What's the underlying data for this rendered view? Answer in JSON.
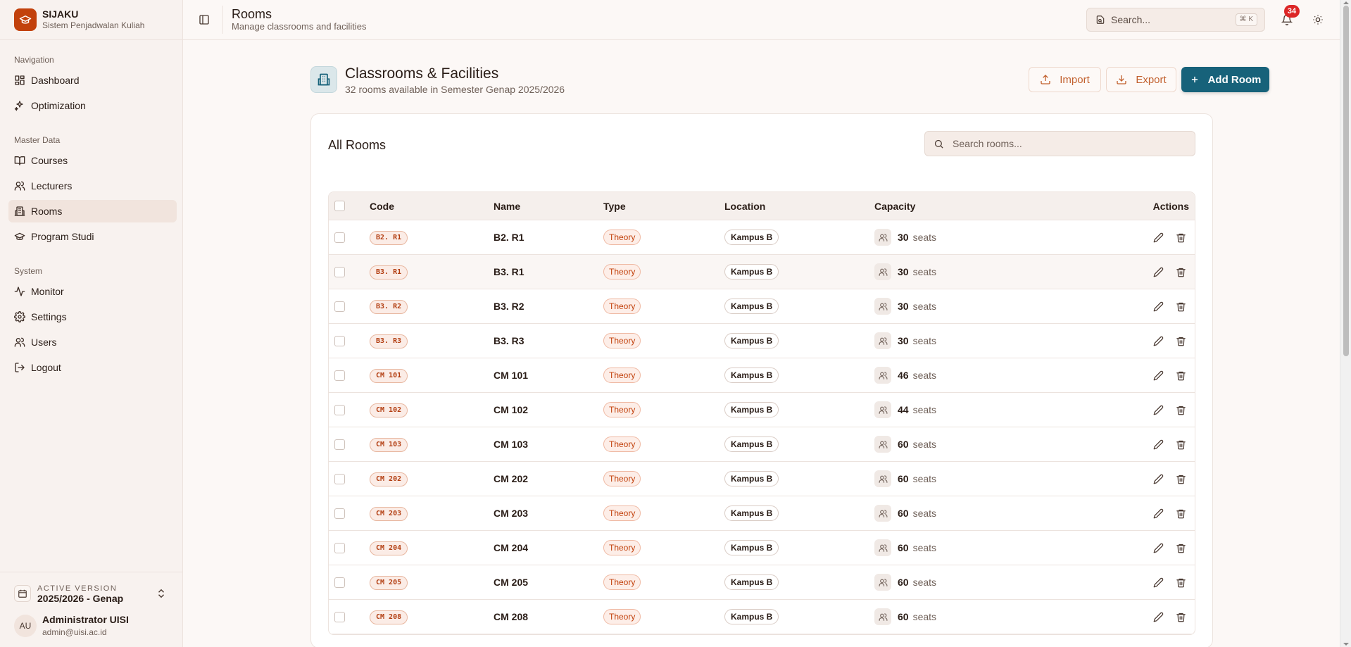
{
  "brand": {
    "title": "SIJAKU",
    "subtitle": "Sistem Penjadwalan Kuliah"
  },
  "sidebar": {
    "groups": [
      {
        "label": "Navigation",
        "items": [
          {
            "label": "Dashboard",
            "icon": "layout-grid-icon"
          },
          {
            "label": "Optimization",
            "icon": "sparkles-icon"
          }
        ]
      },
      {
        "label": "Master Data",
        "items": [
          {
            "label": "Courses",
            "icon": "book-open-icon"
          },
          {
            "label": "Lecturers",
            "icon": "users-icon"
          },
          {
            "label": "Rooms",
            "icon": "building-icon",
            "active": true
          },
          {
            "label": "Program Studi",
            "icon": "graduation-cap-icon"
          }
        ]
      },
      {
        "label": "System",
        "items": [
          {
            "label": "Monitor",
            "icon": "activity-icon"
          },
          {
            "label": "Settings",
            "icon": "gear-icon"
          },
          {
            "label": "Users",
            "icon": "users-icon"
          },
          {
            "label": "Logout",
            "icon": "logout-icon"
          }
        ]
      }
    ],
    "version": {
      "caption": "ACTIVE VERSION",
      "value": "2025/2026 - Genap"
    },
    "user": {
      "initials": "AU",
      "name": "Administrator UISI",
      "email": "admin@uisi.ac.id"
    }
  },
  "topbar": {
    "title": "Rooms",
    "subtitle": "Manage classrooms and facilities",
    "search_placeholder": "Search...",
    "search_shortcut": "⌘ K",
    "notification_count": "34"
  },
  "page": {
    "title": "Classrooms & Facilities",
    "subtitle": "32 rooms available in Semester Genap 2025/2026",
    "import_label": "Import",
    "export_label": "Export",
    "add_label": "Add Room"
  },
  "card": {
    "title": "All Rooms",
    "search_placeholder": "Search rooms..."
  },
  "table": {
    "columns": {
      "code": "Code",
      "name": "Name",
      "type": "Type",
      "location": "Location",
      "capacity": "Capacity",
      "actions": "Actions"
    },
    "unit": "seats",
    "rows": [
      {
        "code": "B2. R1",
        "name": "B2. R1",
        "type": "Theory",
        "location": "Kampus B",
        "capacity": "30"
      },
      {
        "code": "B3. R1",
        "name": "B3. R1",
        "type": "Theory",
        "location": "Kampus B",
        "capacity": "30"
      },
      {
        "code": "B3. R2",
        "name": "B3. R2",
        "type": "Theory",
        "location": "Kampus B",
        "capacity": "30"
      },
      {
        "code": "B3. R3",
        "name": "B3. R3",
        "type": "Theory",
        "location": "Kampus B",
        "capacity": "30"
      },
      {
        "code": "CM 101",
        "name": "CM 101",
        "type": "Theory",
        "location": "Kampus B",
        "capacity": "46"
      },
      {
        "code": "CM 102",
        "name": "CM 102",
        "type": "Theory",
        "location": "Kampus B",
        "capacity": "44"
      },
      {
        "code": "CM 103",
        "name": "CM 103",
        "type": "Theory",
        "location": "Kampus B",
        "capacity": "60"
      },
      {
        "code": "CM 202",
        "name": "CM 202",
        "type": "Theory",
        "location": "Kampus B",
        "capacity": "60"
      },
      {
        "code": "CM 203",
        "name": "CM 203",
        "type": "Theory",
        "location": "Kampus B",
        "capacity": "60"
      },
      {
        "code": "CM 204",
        "name": "CM 204",
        "type": "Theory",
        "location": "Kampus B",
        "capacity": "60"
      },
      {
        "code": "CM 205",
        "name": "CM 205",
        "type": "Theory",
        "location": "Kampus B",
        "capacity": "60"
      },
      {
        "code": "CM 208",
        "name": "CM 208",
        "type": "Theory",
        "location": "Kampus B",
        "capacity": "60"
      }
    ]
  },
  "colors": {
    "accent": "#c2410c",
    "primary": "#17627a",
    "badge": "#dc2626"
  }
}
